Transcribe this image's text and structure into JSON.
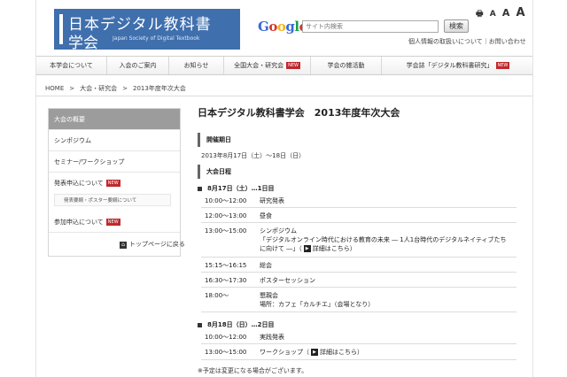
{
  "header": {
    "logo_line1": "日本デジタル教科書",
    "logo_line2": "学会",
    "logo_sub": "Japan Society of Digital Textbook",
    "google_letters": [
      "G",
      "o",
      "o",
      "g",
      "l",
      "e"
    ],
    "search_placeholder": "サイト内検索",
    "search_button": "検索",
    "font_controls": [
      "A",
      "A",
      "A"
    ],
    "top_link1": "個人情報の取扱いについて",
    "top_link_sep": "｜",
    "top_link2": "お問い合わせ"
  },
  "nav": {
    "items": [
      {
        "label": "本学会について",
        "new": ""
      },
      {
        "label": "入会のご案内",
        "new": ""
      },
      {
        "label": "お知らせ",
        "new": ""
      },
      {
        "label": "全国大会・研究会",
        "new": "NEW"
      },
      {
        "label": "学会の雑活動",
        "new": ""
      },
      {
        "label": "学会誌「デジタル教科書研究」",
        "new": "NEW"
      }
    ]
  },
  "breadcrumb": {
    "items": [
      "HOME",
      "大会・研究会",
      "2013年度年次大会"
    ],
    "separator": ">"
  },
  "side": {
    "items": [
      {
        "label": "大会の概要",
        "new": ""
      },
      {
        "label": "シンポジウム",
        "new": ""
      },
      {
        "label": "セミナー/ワークショップ",
        "new": ""
      },
      {
        "label": "発表申込について",
        "new": "NEW"
      },
      {
        "label": "参加申込について",
        "new": "NEW"
      }
    ],
    "sub_item": "発表要綱・ポスター要綱について",
    "back_to_top": "トップページに戻る"
  },
  "main": {
    "title": "日本デジタル教科書学会　2013年度年次大会",
    "dates_head": "開催期日",
    "dates": "2013年8月17日（土）～18日（日）",
    "schedule_head": "大会日程",
    "day1": {
      "label": "8月17日（土）…1日目",
      "rows": [
        {
          "time": "10:00～12:00",
          "event": "研究発表"
        },
        {
          "time": "12:00～13:00",
          "event": "昼食"
        },
        {
          "time": "13:00～15:00",
          "event": "シンポジウム",
          "detail": "「デジタルオンライン時代における教育の未来 ― 1人1台時代のデジタルネイティブたちに向けて ―」（",
          "link": "詳細はこちら",
          "close": "）"
        },
        {
          "time": "15:15～16:15",
          "event": "総会"
        },
        {
          "time": "16:30～17:30",
          "event": "ポスターセッション"
        },
        {
          "time": "18:00～",
          "event": "懇親会",
          "detail": "場所：カフェ「カルチエ」（会場となり）"
        }
      ]
    },
    "day2": {
      "label": "8月18日（日）…2日目",
      "rows": [
        {
          "time": "10:00～12:00",
          "event": "実践発表"
        },
        {
          "time": "13:00～15:00",
          "event": "ワークショップ（",
          "link": "詳細はこちら",
          "close": "）"
        }
      ]
    },
    "note": "※予定は変更になる場合がございます。"
  },
  "colors": {
    "logo_bg": "#3f6fad",
    "new_badge": "#c0282d",
    "active_side": "#9c9c9c"
  }
}
